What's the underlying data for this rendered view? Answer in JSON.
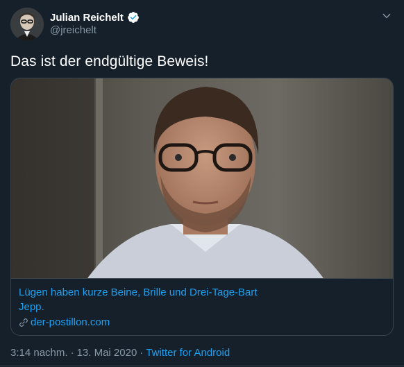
{
  "user": {
    "display_name": "Julian Reichelt",
    "handle": "@jreichelt",
    "verified": true
  },
  "tweet": {
    "text": "Das ist der endgültige Beweis!",
    "time": "3:14 nachm.",
    "date": "13. Mai 2020",
    "source": "Twitter for Android",
    "separator": "·"
  },
  "card": {
    "title": "Lügen haben kurze Beine, Brille und Drei-Tage-Bart",
    "description": "Jepp.",
    "domain": "der-postillon.com"
  },
  "icons": {
    "verified": "verified-badge-icon",
    "caret": "chevron-down-icon",
    "link": "link-icon"
  },
  "colors": {
    "background": "#15202b",
    "accent": "#1da1f2",
    "secondary_text": "#8899a6",
    "border": "#38444d"
  }
}
